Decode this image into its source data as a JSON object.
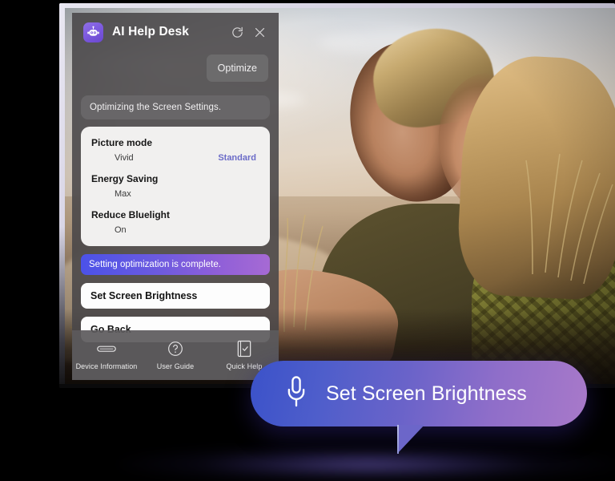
{
  "app": {
    "title": "AI Help Desk",
    "logo_icon": "robot-face-icon",
    "refresh_icon": "refresh-icon",
    "close_icon": "close-icon",
    "optimize_label": "Optimize"
  },
  "status": {
    "message": "Optimizing the Screen Settings."
  },
  "settings": [
    {
      "label": "Picture mode",
      "current": "Vivid",
      "suggested": "Standard"
    },
    {
      "label": "Energy Saving",
      "current": "Max",
      "suggested": ""
    },
    {
      "label": "Reduce Bluelight",
      "current": "On",
      "suggested": ""
    }
  ],
  "actions": {
    "complete_banner": "Setting optimization is complete.",
    "primary": "Set Screen Brightness",
    "secondary": "Go Back"
  },
  "nav": [
    {
      "label": "Device Information",
      "icon": "monitor-icon"
    },
    {
      "label": "User Guide",
      "icon": "question-circle-icon"
    },
    {
      "label": "Quick Help",
      "icon": "document-check-icon"
    }
  ],
  "voice": {
    "command": "Set Screen Brightness",
    "mic_icon": "microphone-icon"
  },
  "colors": {
    "accent_suggested": "#6c6cc8",
    "banner_gradient_start": "#4b52e8",
    "banner_gradient_end": "#a66ad4",
    "bubble_gradient_start": "#3b52c9",
    "bubble_gradient_end": "#a879c9",
    "logo_purple": "#7a57dd",
    "panel_background": "#484648",
    "card_background": "#f1f0ef"
  }
}
